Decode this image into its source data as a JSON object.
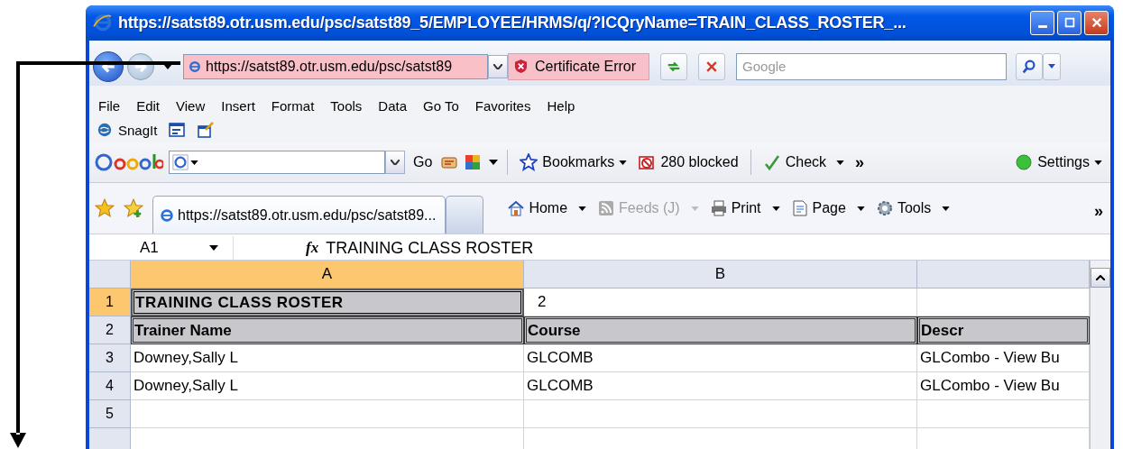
{
  "window": {
    "title": "https://satst89.otr.usm.edu/psc/satst89_5/EMPLOYEE/HRMS/q/?ICQryName=TRAIN_CLASS_ROSTER_..."
  },
  "address_bar": {
    "url": "https://satst89.otr.usm.edu/psc/satst89",
    "certificate_error": "Certificate Error",
    "search_placeholder": "Google"
  },
  "menu": [
    "File",
    "Edit",
    "View",
    "Insert",
    "Format",
    "Tools",
    "Data",
    "Go To",
    "Favorites",
    "Help"
  ],
  "links_bar": {
    "label": "SnagIt"
  },
  "google_toolbar": {
    "go": "Go",
    "bookmarks": "Bookmarks",
    "blocked": "280 blocked",
    "check": "Check",
    "more": "»",
    "settings": "Settings"
  },
  "tabs": [
    {
      "label": "https://satst89.otr.usm.edu/psc/satst89...",
      "selected": true
    }
  ],
  "command_bar": [
    {
      "label": "Home",
      "disabled": false,
      "kind": "home"
    },
    {
      "label": "Feeds (J)",
      "disabled": true,
      "kind": "feeds"
    },
    {
      "label": "Print",
      "disabled": false,
      "kind": "print"
    },
    {
      "label": "Page",
      "disabled": false,
      "kind": "page"
    },
    {
      "label": "Tools",
      "disabled": false,
      "kind": "tools"
    }
  ],
  "command_more": "»",
  "formula_bar": {
    "cell": "A1",
    "fx": "fx",
    "value": "TRAINING CLASS ROSTER"
  },
  "sheet": {
    "columns": [
      {
        "label": "A",
        "selected": true
      },
      {
        "label": "B",
        "selected": false
      },
      {
        "selected": false
      }
    ],
    "rows": [
      {
        "number": "1",
        "selected": true,
        "kind": "title",
        "cells": [
          "TRAINING CLASS ROSTER",
          "2",
          ""
        ]
      },
      {
        "number": "2",
        "selected": false,
        "kind": "header",
        "cells": [
          "Trainer Name",
          "Course",
          "Descr"
        ]
      },
      {
        "number": "3",
        "selected": false,
        "kind": "data",
        "cells": [
          "Downey,Sally L",
          "GLCOMB",
          "GLCombo - View Bu"
        ]
      },
      {
        "number": "4",
        "selected": false,
        "kind": "data",
        "cells": [
          "Downey,Sally L",
          "GLCOMB",
          "GLCombo - View Bu"
        ]
      },
      {
        "number": "5",
        "selected": false,
        "kind": "data",
        "cells": [
          "",
          "",
          ""
        ]
      },
      {
        "selected": false,
        "kind": "data",
        "cells": [
          "",
          "",
          ""
        ]
      }
    ]
  }
}
